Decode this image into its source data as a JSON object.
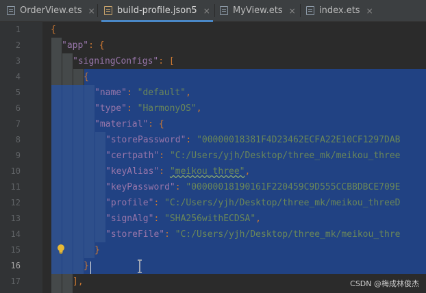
{
  "tabs": [
    {
      "label": "OrderView.ets",
      "icon": "ets-file-icon",
      "active": false
    },
    {
      "label": "build-profile.json5",
      "icon": "json-file-icon",
      "active": true
    },
    {
      "label": "MyView.ets",
      "icon": "ets-file-icon",
      "active": false
    },
    {
      "label": "index.ets",
      "icon": "ets-file-icon",
      "active": false
    }
  ],
  "tab_close_glyph": "×",
  "editor": {
    "current_line": 16,
    "line_numbers": [
      "1",
      "2",
      "3",
      "4",
      "5",
      "6",
      "7",
      "8",
      "9",
      "10",
      "11",
      "12",
      "13",
      "14",
      "15",
      "16",
      "17"
    ],
    "lines": {
      "l1": "{",
      "l2_key": "\"app\"",
      "l2_rest": ": {",
      "l3_key": "\"signingConfigs\"",
      "l3_rest": ": [",
      "l4": "{",
      "l5_key": "\"name\"",
      "l5_val": "\"default\"",
      "l6_key": "\"type\"",
      "l6_val": "\"HarmonyOS\"",
      "l7_key": "\"material\"",
      "l7_rest": ": {",
      "l8_key": "\"storePassword\"",
      "l8_val": "\"00000018381F4D23462ECFA22E10CF1297DAB",
      "l9_key": "\"certpath\"",
      "l9_val": "\"C:/Users/yjh/Desktop/three_mk/meikou_three",
      "l10_key": "\"keyAlias\"",
      "l10_val": "\"meikou_three\"",
      "l11_key": "\"keyPassword\"",
      "l11_val": "\"00000018190161F220459C9D555CCBBDBCE709E",
      "l12_key": "\"profile\"",
      "l12_val": "\"C:/Users/yjh/Desktop/three_mk/meikou_threeD",
      "l13_key": "\"signAlg\"",
      "l13_val": "\"SHA256withECDSA\"",
      "l14_key": "\"storeFile\"",
      "l14_val": "\"C:/Users/yjh/Desktop/three_mk/meikou_thre",
      "l15": "}",
      "l16": "}",
      "l17": "],"
    }
  },
  "watermark": "CSDN @梅成林俊杰",
  "colors": {
    "selection": "#214283",
    "key": "#9876aa",
    "string": "#6a8759",
    "punct": "#cc7832"
  }
}
